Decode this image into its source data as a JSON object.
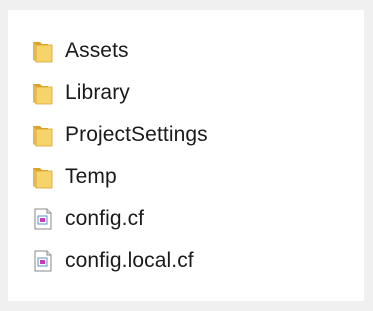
{
  "explorer": {
    "items": [
      {
        "name": "Assets",
        "icon": "folder-icon"
      },
      {
        "name": "Library",
        "icon": "folder-icon"
      },
      {
        "name": "ProjectSettings",
        "icon": "folder-icon"
      },
      {
        "name": "Temp",
        "icon": "folder-icon"
      },
      {
        "name": "config.cf",
        "icon": "file-icon"
      },
      {
        "name": "config.local.cf",
        "icon": "file-icon"
      }
    ]
  },
  "colors": {
    "folder_light": "#f6d36b",
    "folder_dark": "#d9a42c",
    "file_border": "#8a8a8a",
    "file_accent": "#c93bb3"
  }
}
